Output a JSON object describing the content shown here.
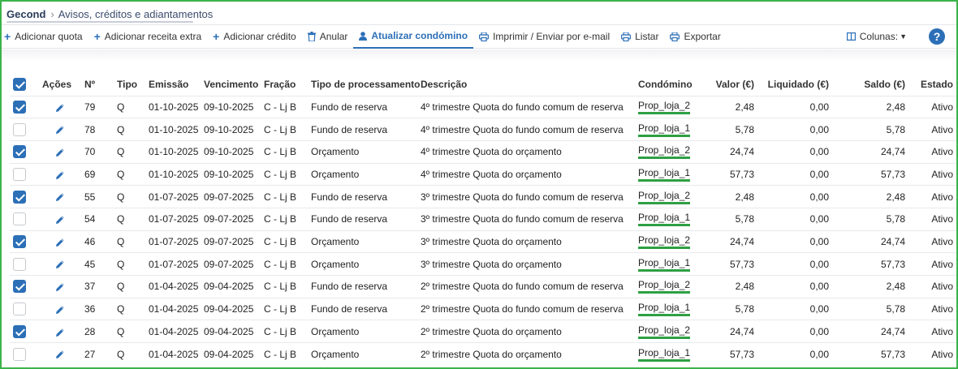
{
  "breadcrumb": {
    "root": "Gecond",
    "page": "Avisos, créditos e adiantamentos"
  },
  "toolbar": {
    "add_quota": "Adicionar quota",
    "add_extra": "Adicionar receita extra",
    "add_credit": "Adicionar crédito",
    "cancel": "Anular",
    "update_condo": "Atualizar condómino",
    "print_email": "Imprimir / Enviar por e-mail",
    "list": "Listar",
    "export": "Exportar",
    "columns": "Colunas:",
    "help": "?"
  },
  "colors": {
    "accent": "#2c6fb7",
    "highlight": "#2ea043",
    "frame": "#3cb34a"
  },
  "icons": [
    "plus-icon",
    "trash-icon",
    "user-icon",
    "printer-icon",
    "columns-icon",
    "help-icon",
    "pencil-icon"
  ],
  "table": {
    "headers": {
      "acoes": "Ações",
      "num": "Nº",
      "tipo": "Tipo",
      "emissao": "Emissão",
      "vencimento": "Vencimento",
      "fracao": "Fração",
      "tipo_proc": "Tipo de processamento",
      "descricao": "Descrição",
      "condomino": "Condómino",
      "valor": "Valor (€)",
      "liquidado": "Liquidado (€)",
      "saldo": "Saldo (€)",
      "estado": "Estado"
    },
    "header_checked": true,
    "rows": [
      {
        "checked": true,
        "num": "79",
        "tipo": "Q",
        "emissao": "01-10-2025",
        "vencimento": "09-10-2025",
        "fracao": "C - Lj B",
        "tipo_proc": "Fundo de reserva",
        "descricao": "4º trimestre Quota do fundo comum de reserva",
        "condomino": "Prop_loja_2",
        "valor": "2,48",
        "liquidado": "0,00",
        "saldo": "2,48",
        "estado": "Ativo"
      },
      {
        "checked": false,
        "num": "78",
        "tipo": "Q",
        "emissao": "01-10-2025",
        "vencimento": "09-10-2025",
        "fracao": "C - Lj B",
        "tipo_proc": "Fundo de reserva",
        "descricao": "4º trimestre Quota do fundo comum de reserva",
        "condomino": "Prop_loja_1",
        "valor": "5,78",
        "liquidado": "0,00",
        "saldo": "5,78",
        "estado": "Ativo"
      },
      {
        "checked": true,
        "num": "70",
        "tipo": "Q",
        "emissao": "01-10-2025",
        "vencimento": "09-10-2025",
        "fracao": "C - Lj B",
        "tipo_proc": "Orçamento",
        "descricao": "4º trimestre Quota do orçamento",
        "condomino": "Prop_loja_2",
        "valor": "24,74",
        "liquidado": "0,00",
        "saldo": "24,74",
        "estado": "Ativo"
      },
      {
        "checked": false,
        "num": "69",
        "tipo": "Q",
        "emissao": "01-10-2025",
        "vencimento": "09-10-2025",
        "fracao": "C - Lj B",
        "tipo_proc": "Orçamento",
        "descricao": "4º trimestre Quota do orçamento",
        "condomino": "Prop_loja_1",
        "valor": "57,73",
        "liquidado": "0,00",
        "saldo": "57,73",
        "estado": "Ativo"
      },
      {
        "checked": true,
        "num": "55",
        "tipo": "Q",
        "emissao": "01-07-2025",
        "vencimento": "09-07-2025",
        "fracao": "C - Lj B",
        "tipo_proc": "Fundo de reserva",
        "descricao": "3º trimestre Quota do fundo comum de reserva",
        "condomino": "Prop_loja_2",
        "valor": "2,48",
        "liquidado": "0,00",
        "saldo": "2,48",
        "estado": "Ativo"
      },
      {
        "checked": false,
        "num": "54",
        "tipo": "Q",
        "emissao": "01-07-2025",
        "vencimento": "09-07-2025",
        "fracao": "C - Lj B",
        "tipo_proc": "Fundo de reserva",
        "descricao": "3º trimestre Quota do fundo comum de reserva",
        "condomino": "Prop_loja_1",
        "valor": "5,78",
        "liquidado": "0,00",
        "saldo": "5,78",
        "estado": "Ativo"
      },
      {
        "checked": true,
        "num": "46",
        "tipo": "Q",
        "emissao": "01-07-2025",
        "vencimento": "09-07-2025",
        "fracao": "C - Lj B",
        "tipo_proc": "Orçamento",
        "descricao": "3º trimestre Quota do orçamento",
        "condomino": "Prop_loja_2",
        "valor": "24,74",
        "liquidado": "0,00",
        "saldo": "24,74",
        "estado": "Ativo"
      },
      {
        "checked": false,
        "num": "45",
        "tipo": "Q",
        "emissao": "01-07-2025",
        "vencimento": "09-07-2025",
        "fracao": "C - Lj B",
        "tipo_proc": "Orçamento",
        "descricao": "3º trimestre Quota do orçamento",
        "condomino": "Prop_loja_1",
        "valor": "57,73",
        "liquidado": "0,00",
        "saldo": "57,73",
        "estado": "Ativo"
      },
      {
        "checked": true,
        "num": "37",
        "tipo": "Q",
        "emissao": "01-04-2025",
        "vencimento": "09-04-2025",
        "fracao": "C - Lj B",
        "tipo_proc": "Fundo de reserva",
        "descricao": "2º trimestre Quota do fundo comum de reserva",
        "condomino": "Prop_loja_2",
        "valor": "2,48",
        "liquidado": "0,00",
        "saldo": "2,48",
        "estado": "Ativo"
      },
      {
        "checked": false,
        "num": "36",
        "tipo": "Q",
        "emissao": "01-04-2025",
        "vencimento": "09-04-2025",
        "fracao": "C - Lj B",
        "tipo_proc": "Fundo de reserva",
        "descricao": "2º trimestre Quota do fundo comum de reserva",
        "condomino": "Prop_loja_1",
        "valor": "5,78",
        "liquidado": "0,00",
        "saldo": "5,78",
        "estado": "Ativo"
      },
      {
        "checked": true,
        "num": "28",
        "tipo": "Q",
        "emissao": "01-04-2025",
        "vencimento": "09-04-2025",
        "fracao": "C - Lj B",
        "tipo_proc": "Orçamento",
        "descricao": "2º trimestre Quota do orçamento",
        "condomino": "Prop_loja_2",
        "valor": "24,74",
        "liquidado": "0,00",
        "saldo": "24,74",
        "estado": "Ativo"
      },
      {
        "checked": false,
        "num": "27",
        "tipo": "Q",
        "emissao": "01-04-2025",
        "vencimento": "09-04-2025",
        "fracao": "C - Lj B",
        "tipo_proc": "Orçamento",
        "descricao": "2º trimestre Quota do orçamento",
        "condomino": "Prop_loja_1",
        "valor": "57,73",
        "liquidado": "0,00",
        "saldo": "57,73",
        "estado": "Ativo"
      }
    ]
  }
}
